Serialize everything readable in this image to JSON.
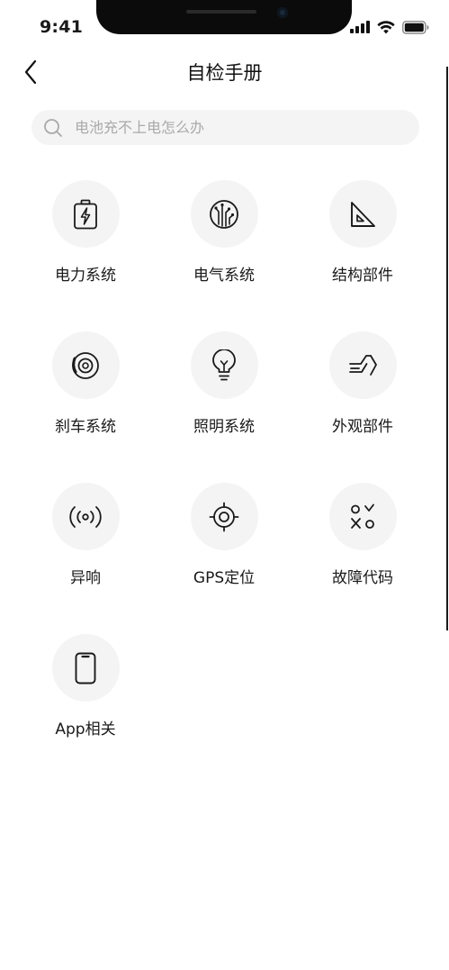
{
  "status_bar": {
    "time": "9:41"
  },
  "nav": {
    "title": "自检手册"
  },
  "search": {
    "placeholder": "电池充不上电怎么办"
  },
  "categories": [
    {
      "label": "电力系统",
      "icon": "battery-icon"
    },
    {
      "label": "电气系统",
      "icon": "circuit-icon"
    },
    {
      "label": "结构部件",
      "icon": "triangle-ruler-icon"
    },
    {
      "label": "刹车系统",
      "icon": "brake-disc-icon"
    },
    {
      "label": "照明系统",
      "icon": "lightbulb-icon"
    },
    {
      "label": "外观部件",
      "icon": "fender-icon"
    },
    {
      "label": "异响",
      "icon": "signal-waves-icon"
    },
    {
      "label": "GPS定位",
      "icon": "gps-target-icon"
    },
    {
      "label": "故障代码",
      "icon": "error-code-icon"
    },
    {
      "label": "App相关",
      "icon": "phone-icon"
    }
  ]
}
